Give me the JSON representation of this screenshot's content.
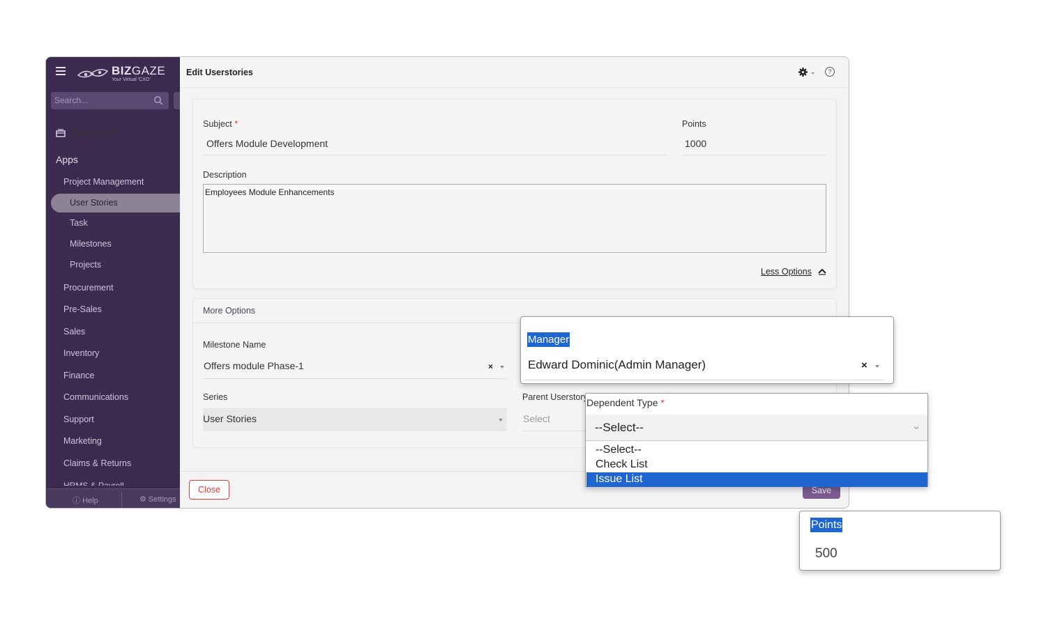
{
  "app": {
    "brand": "BIZ GAZE",
    "brand_bold": "BIZ",
    "brand_light": "GAZE",
    "tagline": "Your Virtual 'CXO'"
  },
  "sidebar": {
    "search_placeholder": "Search...",
    "dashboard": "Dashboard",
    "apps": "Apps",
    "items": [
      {
        "label": "Project Management"
      },
      {
        "label": "User Stories",
        "active": true
      },
      {
        "label": "Task"
      },
      {
        "label": "Milestones"
      },
      {
        "label": "Projects"
      },
      {
        "label": "Procurement"
      },
      {
        "label": "Pre-Sales"
      },
      {
        "label": "Sales"
      },
      {
        "label": "Inventory"
      },
      {
        "label": "Finance"
      },
      {
        "label": "Communications"
      },
      {
        "label": "Support"
      },
      {
        "label": "Marketing"
      },
      {
        "label": "Claims & Returns"
      },
      {
        "label": "HRMS & Payroll"
      }
    ],
    "footer_help": "Help",
    "footer_settings": "Settings"
  },
  "header": {
    "title": "Edit Userstories"
  },
  "form": {
    "subject_label": "Subject",
    "required_mark": "*",
    "subject_value": "Offers Module Development",
    "points_label": "Points",
    "points_value": "1000",
    "description_label": "Description",
    "description_value": "Employees Module Enhancements",
    "less_options": "Less Options",
    "more_options": "More Options",
    "milestone_label": "Milestone Name",
    "milestone_value": "Offers module Phase-1",
    "series_label": "Series",
    "series_value": "User Stories",
    "parent_label": "Parent Userstory",
    "parent_placeholder": "Select",
    "close_button": "Close",
    "save_button": "Save"
  },
  "popups": {
    "manager_label": "Manager",
    "manager_value": "Edward Dominic(Admin Manager)",
    "dependent_label": "Dependent Type",
    "dependent_value": "--Select--",
    "dependent_options": [
      "--Select--",
      "Check List",
      "Issue List"
    ],
    "dependent_highlighted": "Issue List",
    "points_label": "Points",
    "points_value": "500"
  },
  "colors": {
    "sidebar_bg": "#3d2a4f",
    "highlight": "#1f66d1",
    "save_button": "#7a5b8f",
    "close_button": "#e53935"
  }
}
